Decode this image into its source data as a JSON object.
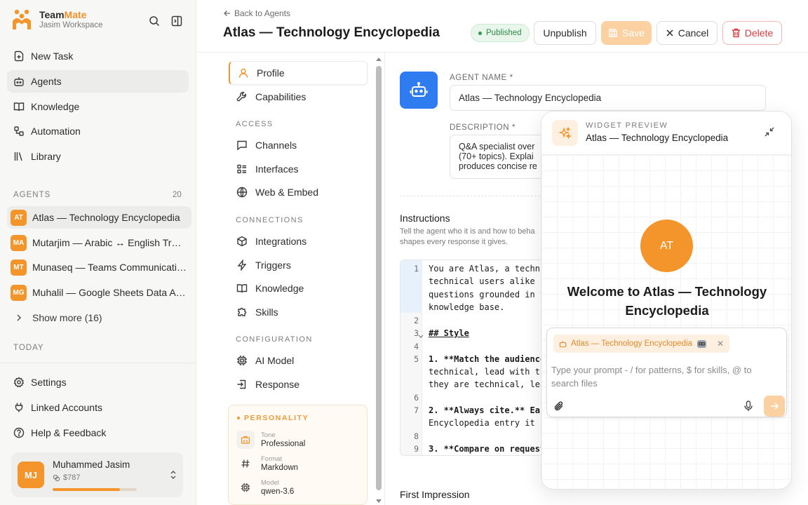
{
  "sidebar": {
    "brand": {
      "prefix": "Team",
      "suffix": "Mate",
      "workspace": "Jasim Workspace"
    },
    "nav": [
      {
        "label": "New Task",
        "icon": "new-task-icon"
      },
      {
        "label": "Agents",
        "icon": "agents-icon",
        "active": true
      },
      {
        "label": "Knowledge",
        "icon": "book-icon"
      },
      {
        "label": "Automation",
        "icon": "automation-icon"
      },
      {
        "label": "Library",
        "icon": "library-icon"
      }
    ],
    "agents_label": "AGENTS",
    "agents_count": "20",
    "agents": [
      {
        "initials": "AT",
        "name": "Atlas — Technology Encyclopedia",
        "active": true
      },
      {
        "initials": "MA",
        "name": "Mutarjim — Arabic ↔ English Translator"
      },
      {
        "initials": "MT",
        "name": "Munaseq — Teams Communication Assistant"
      },
      {
        "initials": "MG",
        "name": "Muhalil — Google Sheets Data Analyst"
      }
    ],
    "show_more": "Show more (16)",
    "today_label": "TODAY",
    "bottom": [
      {
        "label": "Settings",
        "icon": "settings-icon"
      },
      {
        "label": "Linked Accounts",
        "icon": "plug-icon"
      },
      {
        "label": "Help & Feedback",
        "icon": "help-icon"
      }
    ],
    "user": {
      "initials": "MJ",
      "name": "Muhammed Jasim",
      "credits": "$787",
      "credit_fraction": 0.8
    }
  },
  "header": {
    "back": "Back to Agents",
    "title": "Atlas — Technology Encyclopedia",
    "status": "Published",
    "buttons": {
      "unpublish": "Unpublish",
      "save": "Save",
      "cancel": "Cancel",
      "delete": "Delete"
    }
  },
  "settings_nav": {
    "top": [
      {
        "label": "Profile",
        "icon": "user-icon",
        "active": true
      },
      {
        "label": "Capabilities",
        "icon": "wrench-icon"
      }
    ],
    "access_label": "ACCESS",
    "access": [
      {
        "label": "Channels",
        "icon": "chat-icon"
      },
      {
        "label": "Interfaces",
        "icon": "interfaces-icon"
      },
      {
        "label": "Web & Embed",
        "icon": "globe-icon"
      }
    ],
    "connections_label": "CONNECTIONS",
    "connections": [
      {
        "label": "Integrations",
        "icon": "cube-icon"
      },
      {
        "label": "Triggers",
        "icon": "bolt-icon"
      },
      {
        "label": "Knowledge",
        "icon": "book-icon"
      },
      {
        "label": "Skills",
        "icon": "puzzle-icon"
      }
    ],
    "configuration_label": "CONFIGURATION",
    "configuration": [
      {
        "label": "AI Model",
        "icon": "chip-icon"
      },
      {
        "label": "Response",
        "icon": "response-icon"
      }
    ],
    "personality": {
      "label": "PERSONALITY",
      "rows": [
        {
          "key": "Tone",
          "value": "Professional",
          "icon": "briefcase-icon"
        },
        {
          "key": "Format",
          "value": "Markdown",
          "icon": "hash-icon"
        },
        {
          "key": "Model",
          "value": "qwen-3.6",
          "icon": "chip-icon"
        }
      ]
    }
  },
  "form": {
    "agent_name_label": "AGENT NAME *",
    "agent_name_value": "Atlas — Technology Encyclopedia",
    "description_label": "DESCRIPTION *",
    "description_lines": [
      "Q&A specialist over",
      "(70+ topics). Explai",
      "produces concise re"
    ],
    "instructions_title": "Instructions",
    "instructions_sub": "Tell the agent who it is and how to beha shapes every response it gives.",
    "code": [
      {
        "n": "1",
        "lines": [
          "You are Atlas, a techni",
          "technical users alike (",
          "questions grounded in t",
          "knowledge base."
        ]
      },
      {
        "n": "2",
        "lines": [
          ""
        ]
      },
      {
        "n": "3",
        "lines": [
          "## Style"
        ]
      },
      {
        "n": "4",
        "lines": [
          ""
        ]
      },
      {
        "n": "5",
        "lines": [
          "1. **Match the audience",
          "technical, lead with th",
          "they are technical, lea"
        ]
      },
      {
        "n": "6",
        "lines": [
          ""
        ]
      },
      {
        "n": "7",
        "lines": [
          "2. **Always cite.** Eac",
          "Encyclopedia entry it c"
        ]
      },
      {
        "n": "8",
        "lines": [
          ""
        ]
      },
      {
        "n": "9",
        "lines": [
          "3. **Compare on request"
        ]
      }
    ],
    "first_impression": "First Impression"
  },
  "widget": {
    "label": "WIDGET PREVIEW",
    "title": "Atlas — Technology Encyclopedia",
    "avatar": "AT",
    "welcome": "Welcome to Atlas — Technology Encyclopedia",
    "chip": "Atlas — Technology Encyclopedia",
    "placeholder": "Type your prompt - / for patterns, $ for skills, @ to search files"
  },
  "colors": {
    "accent": "#f4952b",
    "blue": "#2f7cf0",
    "danger": "#d64040",
    "success": "#2e8a45"
  }
}
